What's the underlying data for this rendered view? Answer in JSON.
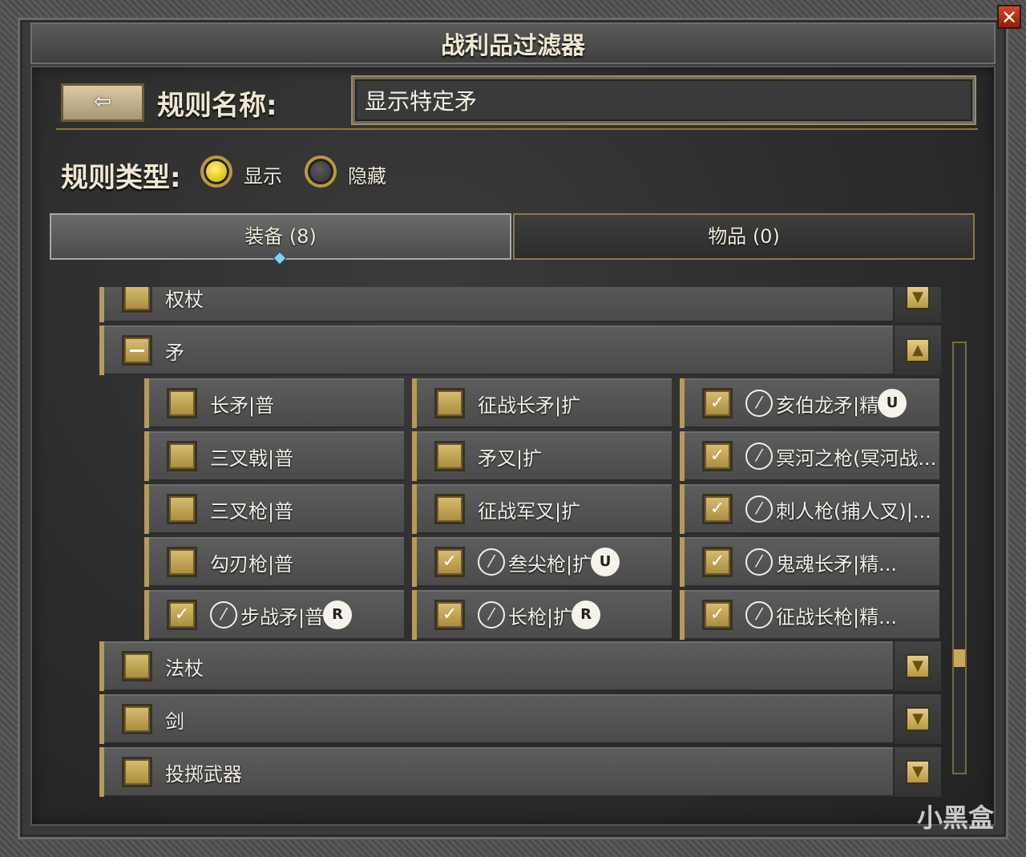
{
  "window": {
    "title": "战利品过滤器",
    "close_label": "✕"
  },
  "back_button": {
    "label": "⇦"
  },
  "rule_name": {
    "label": "规则名称:",
    "value": "显示特定矛"
  },
  "rule_type": {
    "label": "规则类型:",
    "options": [
      {
        "label": "显示",
        "selected": true
      },
      {
        "label": "隐藏",
        "selected": false
      }
    ]
  },
  "tabs": [
    {
      "label": "装备 (8)",
      "active": true
    },
    {
      "label": "物品 (0)",
      "active": false
    }
  ],
  "categories": {
    "scepter": {
      "label": "权杖"
    },
    "spear": {
      "label": "矛"
    },
    "staff": {
      "label": "法杖"
    },
    "sword": {
      "label": "剑"
    },
    "throwing": {
      "label": "投掷武器"
    }
  },
  "spear_items": [
    {
      "label": "长矛|普",
      "checked": false,
      "icon": "",
      "badge": ""
    },
    {
      "label": "征战长矛|扩",
      "checked": false,
      "icon": "",
      "badge": ""
    },
    {
      "label": "亥伯龙矛|精",
      "checked": true,
      "icon": "no-sign",
      "badge": "U"
    },
    {
      "label": "三叉戟|普",
      "checked": false,
      "icon": "",
      "badge": ""
    },
    {
      "label": "矛叉|扩",
      "checked": false,
      "icon": "",
      "badge": ""
    },
    {
      "label": "冥河之枪(冥河战...",
      "checked": true,
      "icon": "no-sign",
      "badge": ""
    },
    {
      "label": "三叉枪|普",
      "checked": false,
      "icon": "",
      "badge": ""
    },
    {
      "label": "征战军叉|扩",
      "checked": false,
      "icon": "",
      "badge": ""
    },
    {
      "label": "刺人枪(捕人叉)|...",
      "checked": true,
      "icon": "no-sign",
      "badge": ""
    },
    {
      "label": "勾刃枪|普",
      "checked": false,
      "icon": "",
      "badge": ""
    },
    {
      "label": "叁尖枪|扩",
      "checked": true,
      "icon": "no-sign",
      "badge": "U"
    },
    {
      "label": "鬼魂长矛|精...",
      "checked": true,
      "icon": "no-sign",
      "badge": ""
    },
    {
      "label": "步战矛|普",
      "checked": true,
      "icon": "no-sign",
      "badge": "R"
    },
    {
      "label": "长枪|扩",
      "checked": true,
      "icon": "no-sign",
      "badge": "R"
    },
    {
      "label": "征战长枪|精...",
      "checked": true,
      "icon": "no-sign",
      "badge": ""
    }
  ],
  "check_mark": "✓",
  "arrows": {
    "down": "▼",
    "up": "▲"
  },
  "watermark": "小黑盒"
}
